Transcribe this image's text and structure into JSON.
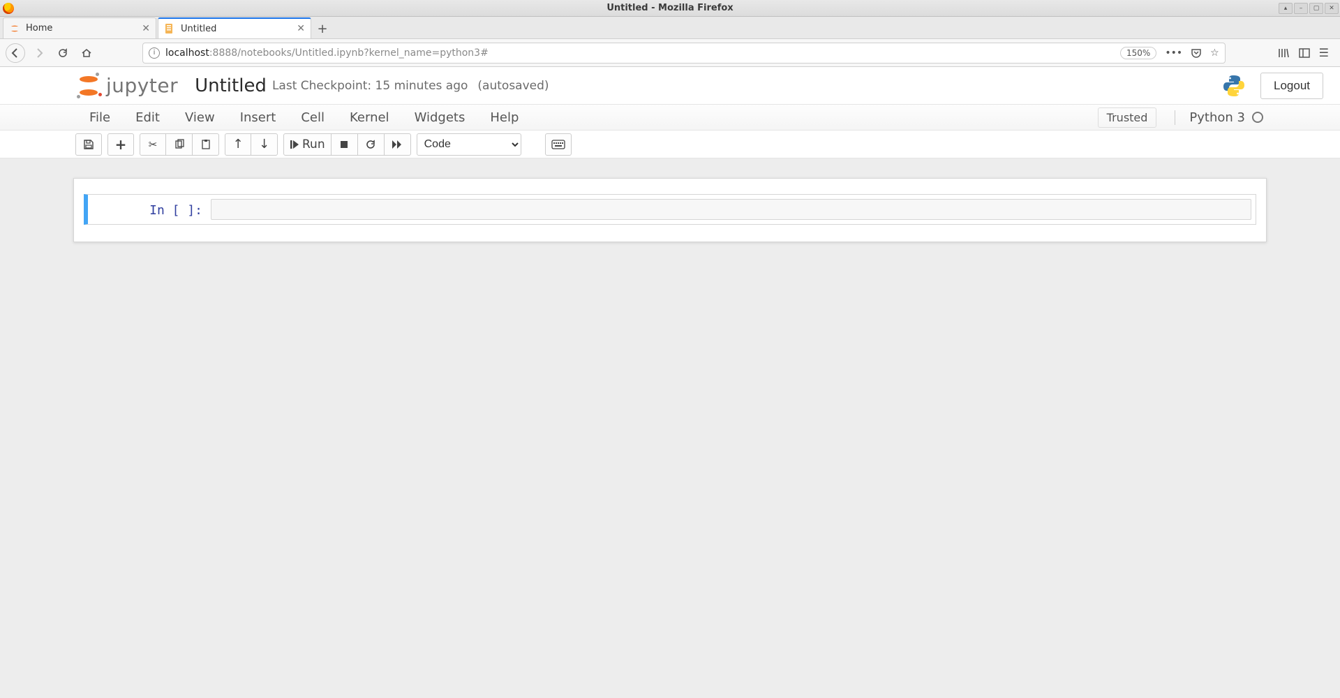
{
  "window": {
    "title": "Untitled - Mozilla Firefox"
  },
  "browser": {
    "tabs": [
      {
        "label": "Home"
      },
      {
        "label": "Untitled"
      }
    ],
    "new_tab_label": "+",
    "url_host": "localhost",
    "url_rest": ":8888/notebooks/Untitled.ipynb?kernel_name=python3#",
    "zoom": "150%"
  },
  "header": {
    "logo_text": "jupyter",
    "notebook_title": "Untitled",
    "checkpoint": "Last Checkpoint: 15 minutes ago",
    "autosave": "(autosaved)",
    "logout": "Logout"
  },
  "menu": {
    "items": [
      "File",
      "Edit",
      "View",
      "Insert",
      "Cell",
      "Kernel",
      "Widgets",
      "Help"
    ],
    "trusted": "Trusted",
    "kernel": "Python 3"
  },
  "toolbar": {
    "run_label": "Run",
    "celltype_selected": "Code"
  },
  "notebook": {
    "cells": [
      {
        "prompt": "In [ ]:",
        "source": ""
      }
    ]
  }
}
